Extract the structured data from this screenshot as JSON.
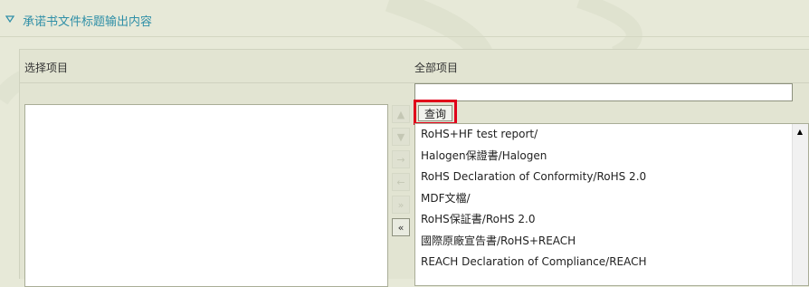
{
  "section": {
    "title": "承诺书文件标题输出内容",
    "icon": "triangle-down-icon"
  },
  "columns": {
    "left_label": "选择项目",
    "right_label": "全部项目"
  },
  "search": {
    "value": "",
    "button_label": "查询"
  },
  "arrows": [
    {
      "icon": "move-up-icon",
      "glyph": "▲",
      "enabled": false
    },
    {
      "icon": "move-down-icon",
      "glyph": "▼",
      "enabled": false
    },
    {
      "icon": "add-selected-icon",
      "glyph": "→",
      "enabled": false
    },
    {
      "icon": "remove-selected-icon",
      "glyph": "←",
      "enabled": false
    },
    {
      "icon": "add-all-icon",
      "glyph": "»",
      "enabled": false
    },
    {
      "icon": "remove-all-icon",
      "glyph": "«",
      "enabled": true
    }
  ],
  "all_items": [
    "RoHS+HF test report/",
    "Halogen保證書/Halogen",
    "RoHS Declaration of Conformity/RoHS 2.0",
    "MDF文檔/",
    "RoHS保証書/RoHS 2.0",
    "國際原廠宣告書/RoHS+REACH",
    "REACH Declaration of Compliance/REACH"
  ],
  "selected_items": [],
  "colors": {
    "title": "#2f8fa7",
    "highlight_border": "#e0001a"
  }
}
